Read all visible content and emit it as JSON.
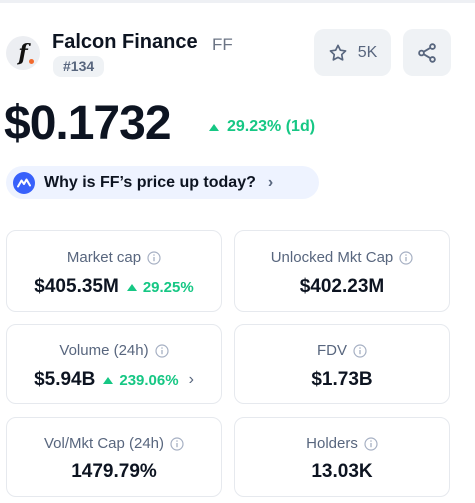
{
  "token": {
    "name": "Falcon Finance",
    "symbol": "FF",
    "rank": "#134",
    "logo_letter": "f"
  },
  "actions": {
    "watchlist_count": "5K",
    "star_icon": "star-icon",
    "share_icon": "share-icon"
  },
  "price": {
    "value": "$0.1732",
    "change": "29.23% (1d)",
    "direction": "up"
  },
  "why_banner": {
    "text": "Why is FF’s price up today?"
  },
  "stats": {
    "market_cap": {
      "label": "Market cap",
      "value": "$405.35M",
      "change": "29.25%"
    },
    "unlocked_mkt_cap": {
      "label": "Unlocked Mkt Cap",
      "value": "$402.23M"
    },
    "volume": {
      "label": "Volume (24h)",
      "value": "$5.94B",
      "change": "239.06%"
    },
    "fdv": {
      "label": "FDV",
      "value": "$1.73B"
    },
    "vol_mkt_cap": {
      "label": "Vol/Mkt Cap (24h)",
      "value": "1479.79%"
    },
    "holders": {
      "label": "Holders",
      "value": "13.03K"
    }
  },
  "colors": {
    "positive": "#16c784",
    "text_primary": "#0d1421",
    "text_secondary": "#58667e",
    "button_bg": "#eff2f5",
    "banner_bg": "#eef3ff"
  }
}
